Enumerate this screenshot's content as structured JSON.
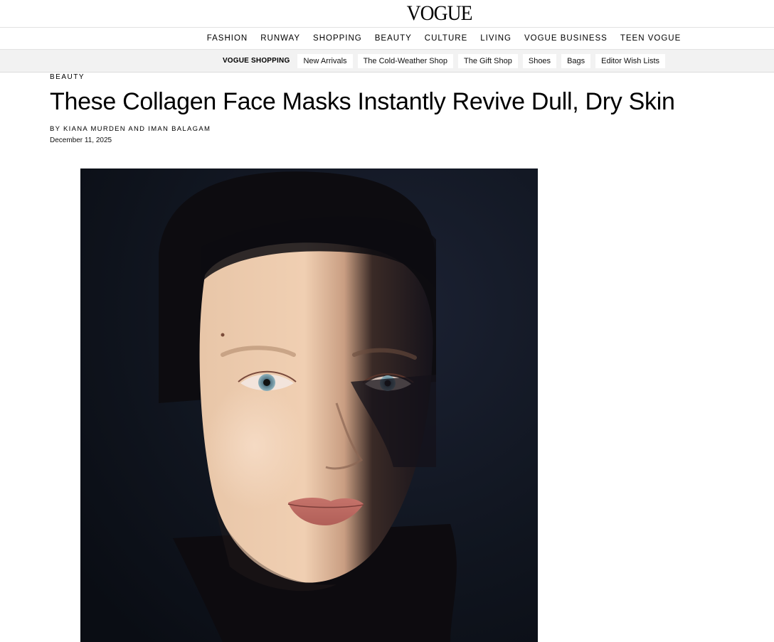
{
  "brand": {
    "logo": "VOGUE"
  },
  "nav": {
    "items": [
      "FASHION",
      "RUNWAY",
      "SHOPPING",
      "BEAUTY",
      "CULTURE",
      "LIVING",
      "VOGUE BUSINESS",
      "TEEN VOGUE"
    ]
  },
  "shopping": {
    "title": "VOGUE SHOPPING",
    "links": [
      "New Arrivals",
      "The Cold-Weather Shop",
      "The Gift Shop",
      "Shoes",
      "Bags",
      "Editor Wish Lists"
    ]
  },
  "article": {
    "rubric": "BEAUTY",
    "headline": "These Collagen Face Masks Instantly Revive Dull, Dry Skin",
    "byline": "BY KIANA MURDEN AND IMAN BALAGAM",
    "date": "December 11, 2025"
  },
  "colors": {
    "background": "#ffffff",
    "text": "#000000",
    "shop_bar": "#f2f2f2",
    "photo_background": "#0f1525"
  }
}
